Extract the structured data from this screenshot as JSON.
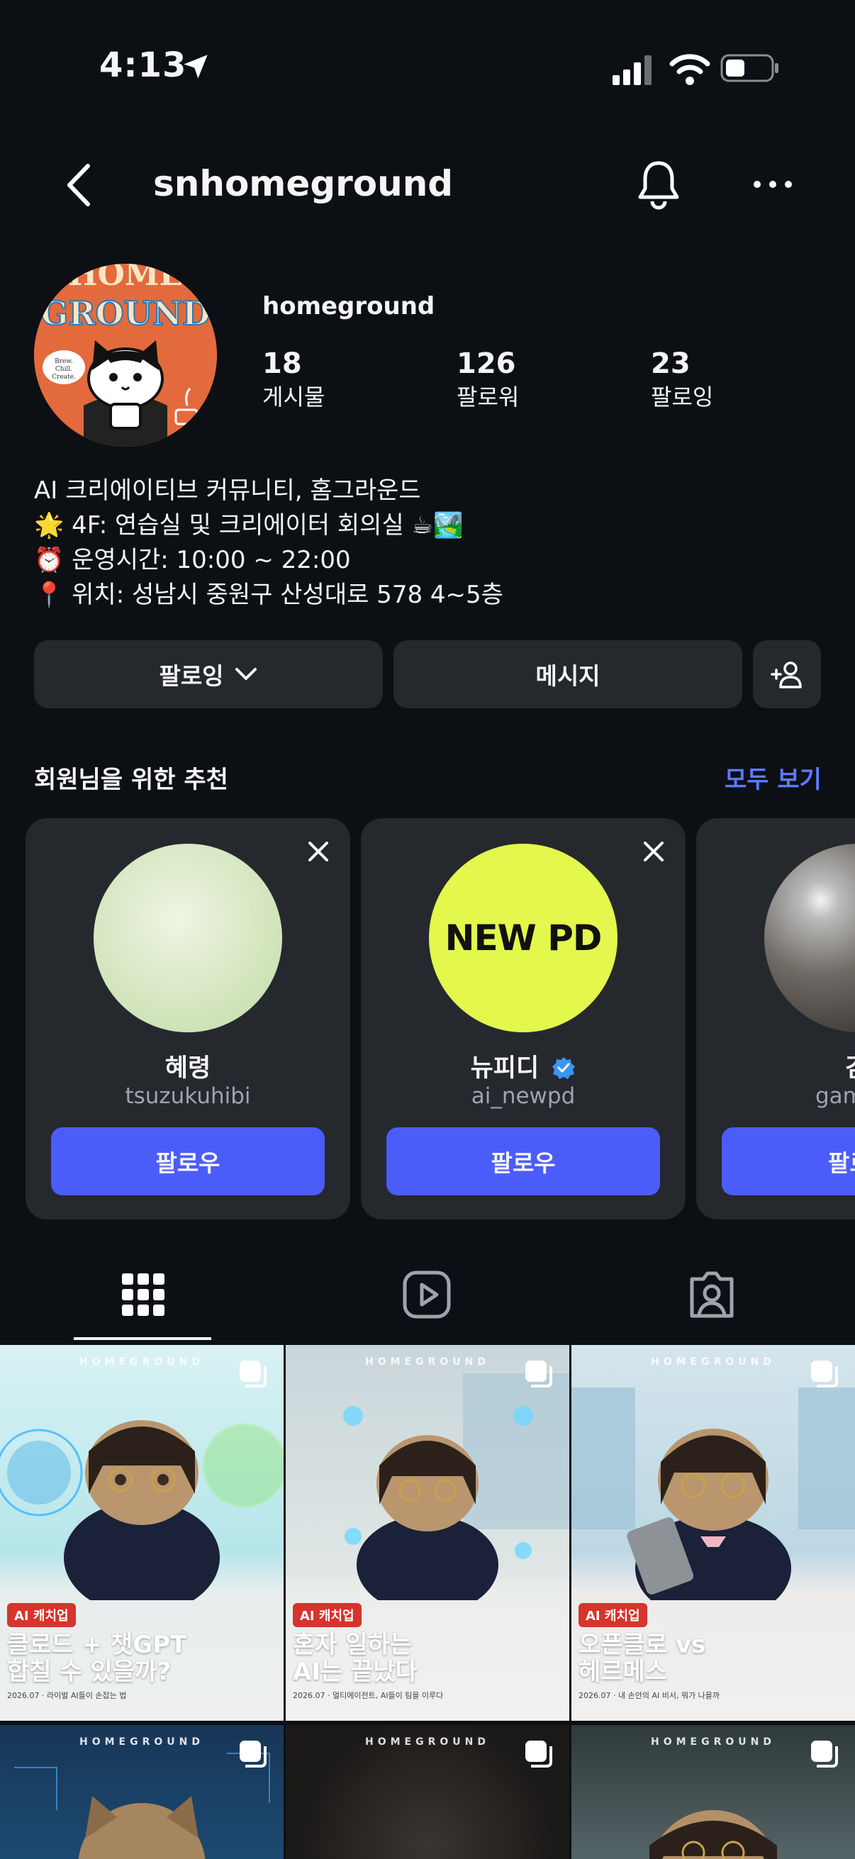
{
  "status_bar": {
    "time": "4:13"
  },
  "header": {
    "username": "snhomeground"
  },
  "profile": {
    "display_name": "homeground",
    "stats": [
      {
        "value": "18",
        "label": "게시물"
      },
      {
        "value": "126",
        "label": "팔로워"
      },
      {
        "value": "23",
        "label": "팔로잉"
      }
    ],
    "avatar_text": {
      "top": "HOME",
      "main": "GROUND",
      "tag": "Brew. Chill. Create."
    },
    "bio": [
      "AI 크리에이티브 커뮤니티, 홈그라운드",
      "🌟 4F: 연습실 및 크리에이터 회의실 ☕🏞️",
      "⏰ 운영시간: 10:00 ~ 22:00",
      "📍 위치: 성남시 중원구 산성대로 578 4~5층"
    ]
  },
  "actions": {
    "following_label": "팔로잉",
    "message_label": "메시지"
  },
  "suggestions": {
    "title": "회원님을 위한 추천",
    "see_all": "모두 보기",
    "cards": [
      {
        "name": "혜령",
        "handle": "tsuzukuhibi",
        "follow_label": "팔로우"
      },
      {
        "name": "뉴피디",
        "handle": "ai_newpd",
        "follow_label": "팔로우",
        "pic_text": "NEW PD"
      },
      {
        "name": "김",
        "handle": "gam",
        "follow_label": "팔로"
      }
    ]
  },
  "grid": {
    "brand": "HOMEGROUND",
    "tiles": [
      {
        "badge": "AI 캐치업",
        "headline": "클로드 + 챗GPT\n합칠 수 있을까?",
        "sub": "2026.07 · 라이벌 AI들이 손잡는 법"
      },
      {
        "badge": "AI 캐치업",
        "headline": "혼자 일하는\nAI는 끝났다",
        "sub": "2026.07 · 멀티에이전트, AI들이 팀을 이루다"
      },
      {
        "badge": "AI 캐치업",
        "headline": "오픈클로 vs\n헤르메스",
        "sub": "2026.07 · 내 손안의 AI 비서, 뭐가 나을까"
      }
    ]
  },
  "colors": {
    "background": "#0c1014",
    "button": "#25292e",
    "accent": "#4a5df9",
    "link": "#5b7bff",
    "badge": "#d6342c"
  }
}
